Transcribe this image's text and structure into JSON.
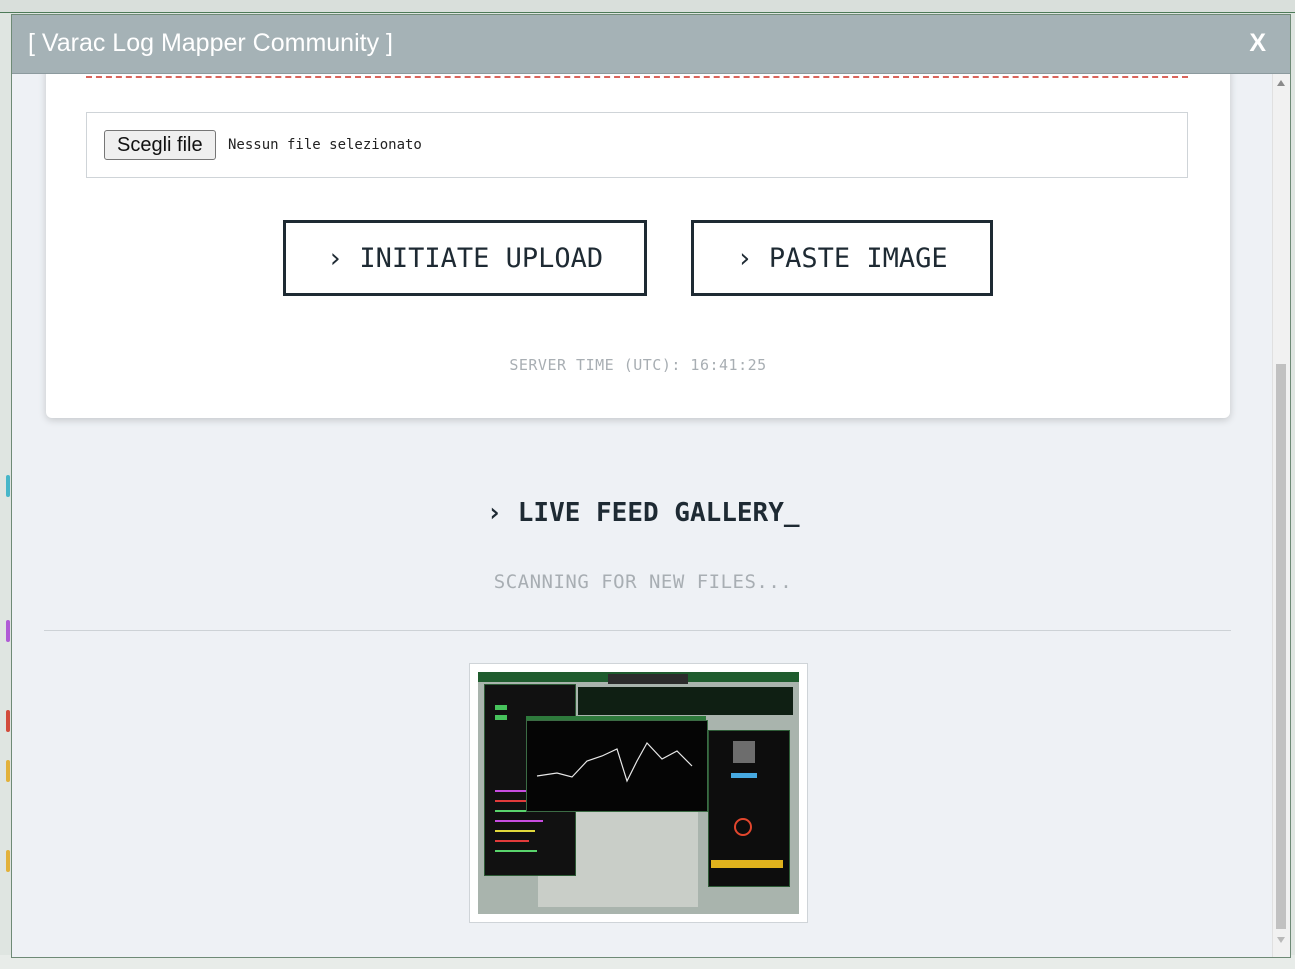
{
  "dialog": {
    "title": "[ Varac Log Mapper Community ]",
    "close_label": "X"
  },
  "upload": {
    "file_button_label": "Scegli file",
    "file_status": "Nessun file selezionato",
    "initiate_upload_label": "› INITIATE UPLOAD",
    "paste_image_label": "› PASTE IMAGE",
    "server_time": "SERVER TIME (UTC): 16:41:25"
  },
  "gallery": {
    "title": "› LIVE FEED GALLERY_",
    "status": "SCANNING FOR NEW FILES...",
    "thumbnails": [
      {
        "label": "screenshot thumbnail"
      }
    ]
  },
  "colors": {
    "titlebar": "#a5b2b6",
    "accent_dark": "#1e2a33",
    "muted_text": "#a8aeb3",
    "dashed_border": "#d9645c"
  }
}
